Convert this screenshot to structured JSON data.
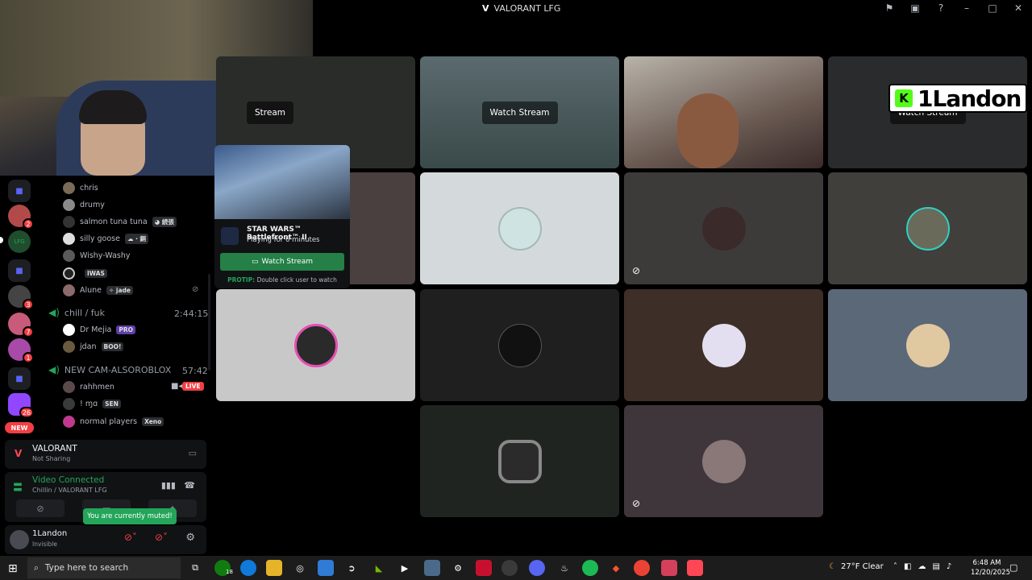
{
  "window": {
    "title": "VALORANT LFG"
  },
  "servers": [
    {
      "badge": ""
    },
    {
      "badge": "2"
    },
    {
      "badge": ""
    },
    {
      "badge": ""
    },
    {
      "badge": "3"
    },
    {
      "badge": "7"
    },
    {
      "badge": "1"
    },
    {
      "badge": ""
    },
    {
      "badge": "26"
    }
  ],
  "servers_new": "NEW",
  "members_top": [
    {
      "name": "chris",
      "tag": ""
    },
    {
      "name": "drumy",
      "tag": ""
    },
    {
      "name": "salmon tuna tuna",
      "tag": "◕ 続張"
    },
    {
      "name": "silly goose",
      "tag": "☁ · 銅"
    },
    {
      "name": "Wishy-Washy",
      "tag": ""
    },
    {
      "name": "",
      "tag": "IWAS"
    },
    {
      "name": "Alune",
      "tag": "✧ jade"
    }
  ],
  "channel_chill": {
    "name": "chill / fuk",
    "time": "2:44:15"
  },
  "members_chill": [
    {
      "name": "Dr Mejia",
      "tag": "PRO"
    },
    {
      "name": "jdan",
      "tag": "BOO!"
    }
  ],
  "channel_newcam": {
    "name": "NEW CAM-ALSOROBLOX",
    "time": "57:42"
  },
  "members_newcam": [
    {
      "name": "rahhmen",
      "live": "LIVE"
    },
    {
      "name": "! ɱɑ",
      "tag": "SEN"
    },
    {
      "name": "normal players",
      "tag": "Xeno"
    }
  ],
  "activity": {
    "game": "VALORANT",
    "status": "Not Sharing"
  },
  "voice": {
    "status": "Video Connected",
    "channel": "Chillin / VALORANT LFG"
  },
  "user": {
    "name": "1Landon",
    "status": "Invisible"
  },
  "tooltip": "You are currently muted!",
  "tiles": {
    "watch_stream": "Watch Stream",
    "stream_partial": "Stream",
    "nameplate": "1Landon",
    "nameplate_logo": "K"
  },
  "popup": {
    "game": "STAR WARS™ Battlefront™ II",
    "playing": "Playing for 6 minutes",
    "watch": "Watch Stream",
    "protip_label": "PROTIP:",
    "protip": "Double click user to watch"
  },
  "taskbar": {
    "search_placeholder": "Type here to search",
    "xbox_badge": "18",
    "weather": "27°F  Clear",
    "time": "6:48 AM",
    "date": "12/20/2025"
  },
  "colors": {
    "accent_green": "#23a55a",
    "danger_red": "#f23f43",
    "valorant_red": "#ff4655",
    "blurple": "#5865f2"
  }
}
